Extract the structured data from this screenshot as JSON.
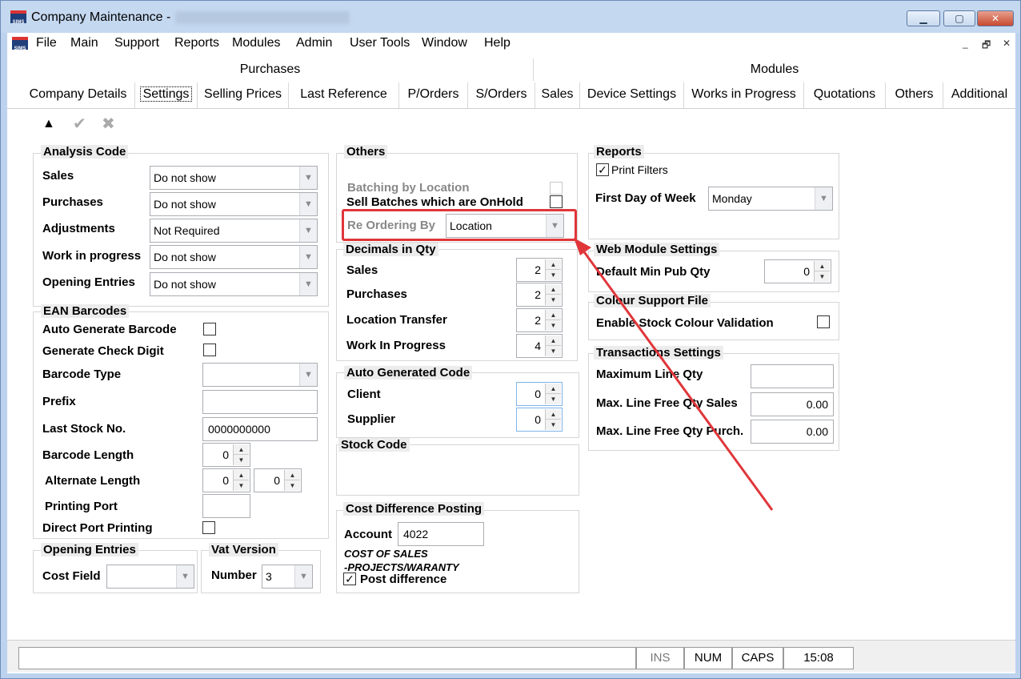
{
  "window": {
    "title": "Company Maintenance -"
  },
  "menu": [
    "File",
    "Main",
    "Support",
    "Reports",
    "Modules",
    "Admin",
    "User Tools",
    "Window",
    "Help"
  ],
  "tab_groups": [
    "Purchases",
    "Modules"
  ],
  "tabs": [
    "Company Details",
    "Settings",
    "Selling Prices",
    "Last Reference",
    "P/Orders",
    "S/Orders",
    "Sales",
    "Device Settings",
    "Works in Progress",
    "Quotations",
    "Others",
    "Additional"
  ],
  "active_tab": "Settings",
  "analysis_code": {
    "title": "Analysis Code",
    "rows": [
      {
        "label": "Sales",
        "value": "Do not show"
      },
      {
        "label": "Purchases",
        "value": "Do not show"
      },
      {
        "label": "Adjustments",
        "value": "Not Required"
      },
      {
        "label": "Work in progress",
        "value": "Do not show"
      },
      {
        "label": "Opening Entries",
        "value": "Do not show"
      }
    ]
  },
  "ean": {
    "title": "EAN Barcodes",
    "auto_generate": "Auto Generate Barcode",
    "check_digit": "Generate Check Digit",
    "barcode_type": "Barcode Type",
    "prefix": "Prefix",
    "last_stock_no": "Last Stock No.",
    "last_stock_no_value": "0000000000",
    "barcode_length": "Barcode Length",
    "barcode_length_value": "0",
    "alternate_length": "Alternate Length",
    "alternate_length_value1": "0",
    "alternate_length_value2": "0",
    "printing_port": "Printing Port",
    "direct_port": "Direct Port Printing"
  },
  "opening_entries": {
    "title": "Opening Entries",
    "cost_field": "Cost Field"
  },
  "vat_version": {
    "title": "Vat Version",
    "number": "Number",
    "value": "3"
  },
  "others": {
    "title": "Others",
    "batching": "Batching by Location",
    "sell_batches": "Sell Batches which are OnHold",
    "reordering": "Re Ordering By",
    "reordering_value": "Location"
  },
  "decimals": {
    "title": "Decimals in Qty",
    "rows": [
      {
        "label": "Sales",
        "value": "2"
      },
      {
        "label": "Purchases",
        "value": "2"
      },
      {
        "label": "Location Transfer",
        "value": "2"
      },
      {
        "label": "Work In Progress",
        "value": "4"
      }
    ]
  },
  "auto_code": {
    "title": "Auto Generated Code",
    "client": "Client",
    "client_value": "0",
    "supplier": "Supplier",
    "supplier_value": "0"
  },
  "stock_code": {
    "title": "Stock Code"
  },
  "cost_diff": {
    "title": "Cost Difference Posting",
    "account": "Account",
    "account_value": "4022",
    "desc1": "COST OF SALES",
    "desc2": "-PROJECTS/WARANTY",
    "post_diff": "Post difference"
  },
  "reports": {
    "title": "Reports",
    "print_filters": "Print Filters",
    "first_day": "First Day of Week",
    "first_day_value": "Monday"
  },
  "web": {
    "title": "Web Module Settings",
    "min_pub": "Default Min Pub Qty",
    "min_pub_value": "0"
  },
  "colour": {
    "title": "Colour Support File",
    "enable": "Enable Stock Colour Validation"
  },
  "transactions": {
    "title": "Transactions Settings",
    "max_line": "Maximum Line Qty",
    "max_free_sales": "Max. Line Free Qty Sales",
    "max_free_sales_value": "0.00",
    "max_free_purch": "Max. Line Free Qty Purch.",
    "max_free_purch_value": "0.00"
  },
  "status": {
    "ins": "INS",
    "num": "NUM",
    "caps": "CAPS",
    "time": "15:08"
  },
  "colors": {
    "annotation": "#e0363a",
    "title_bar": "#c4d8f0"
  }
}
